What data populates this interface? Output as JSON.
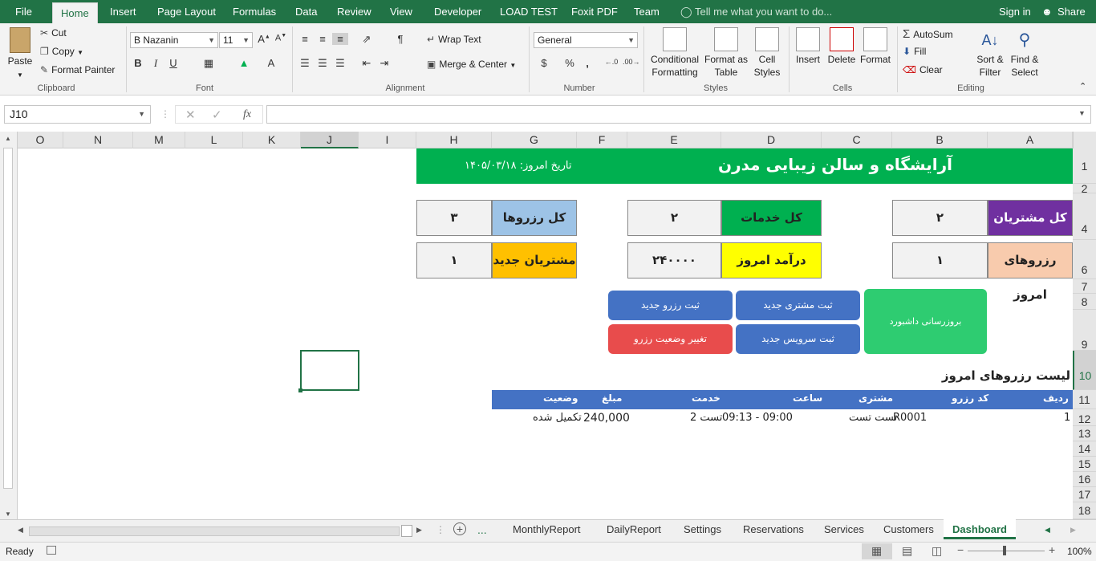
{
  "ribbon_tabs": [
    "File",
    "Home",
    "Insert",
    "Page Layout",
    "Formulas",
    "Data",
    "Review",
    "View",
    "Developer",
    "LOAD TEST",
    "Foxit PDF",
    "Team"
  ],
  "tell_me": "Tell me what you want to do...",
  "sign_in": "Sign in",
  "share": "Share",
  "clipboard": {
    "paste": "Paste",
    "cut": "Cut",
    "copy": "Copy",
    "format_painter": "Format Painter",
    "label": "Clipboard"
  },
  "font": {
    "name": "B Nazanin",
    "size": "11",
    "bold": "B",
    "italic": "I",
    "underline": "U",
    "label": "Font"
  },
  "alignment": {
    "wrap": "Wrap Text",
    "merge": "Merge & Center",
    "label": "Alignment"
  },
  "number": {
    "format": "General",
    "currency": "$",
    "percent": "%",
    "comma": ",",
    "label": "Number"
  },
  "styles": {
    "conditional": "Conditional Formatting",
    "format_table": "Format as Table",
    "cell_styles": "Cell Styles",
    "label": "Styles"
  },
  "cells": {
    "insert": "Insert",
    "delete": "Delete",
    "format": "Format",
    "label": "Cells"
  },
  "editing": {
    "autosum": "AutoSum",
    "fill": "Fill",
    "clear": "Clear",
    "sort": "Sort & Filter",
    "find": "Find & Select",
    "label": "Editing"
  },
  "formula_bar": {
    "name_box": "J10",
    "fx": "fx",
    "value": ""
  },
  "columns": [
    "O",
    "N",
    "M",
    "L",
    "K",
    "J",
    "I",
    "H",
    "G",
    "F",
    "E",
    "D",
    "C",
    "B",
    "A"
  ],
  "rows": [
    "1",
    "2",
    "4",
    "6",
    "7",
    "8",
    "9",
    "10",
    "11",
    "12",
    "13",
    "14",
    "15",
    "16",
    "17",
    "18"
  ],
  "dashboard": {
    "title": "آرایشگاه و سالن زیبایی مدرن",
    "date_label": "تاریخ امروز: ۱۴۰۵/۰۳/۱۸",
    "kpis": {
      "total_customers_label": "کل مشتریان",
      "total_customers": "۲",
      "total_services_label": "کل خدمات",
      "total_services": "۲",
      "total_reservations_label": "کل رزروها",
      "total_reservations": "۳",
      "today_reservations_label": "رزروهای امروز",
      "today_reservations": "۱",
      "today_income_label": "درآمد امروز",
      "today_income": "۲۴۰۰۰۰",
      "new_customers_label": "مشتریان جدید",
      "new_customers": "۱"
    },
    "buttons": {
      "refresh": "بروزرسانی داشبورد",
      "new_customer": "ثبت مشتری جدید",
      "new_reservation": "ثبت رزرو جدید",
      "new_service": "ثبت سرویس جدید",
      "change_status": "تغییر وضعیت رزرو"
    },
    "list_title": "لیست رزروهای امروز",
    "table_headers": [
      "ردیف",
      "کد رزرو",
      "مشتری",
      "ساعت",
      "خدمت",
      "مبلغ",
      "وضعیت"
    ],
    "table_rows": [
      [
        "1",
        "R0001",
        "تست تست",
        "09:00 - 09:13",
        "تست 2",
        "240,000",
        "تکمیل شده"
      ]
    ]
  },
  "sheet_tabs": [
    "MonthlyReport",
    "DailyReport",
    "Settings",
    "Reservations",
    "Services",
    "Customers",
    "Dashboard"
  ],
  "status": {
    "ready": "Ready",
    "zoom": "100%"
  },
  "colors": {
    "green": "#00b050",
    "purple": "#7030a0",
    "yellow": "#ffff00",
    "light_blue": "#9dc3e6",
    "orange": "#ffc000",
    "peach": "#f8cbad",
    "blue_btn": "#4472c4",
    "red_btn": "#e84c4c",
    "green_btn": "#2ecc71",
    "excel_green": "#217346"
  }
}
